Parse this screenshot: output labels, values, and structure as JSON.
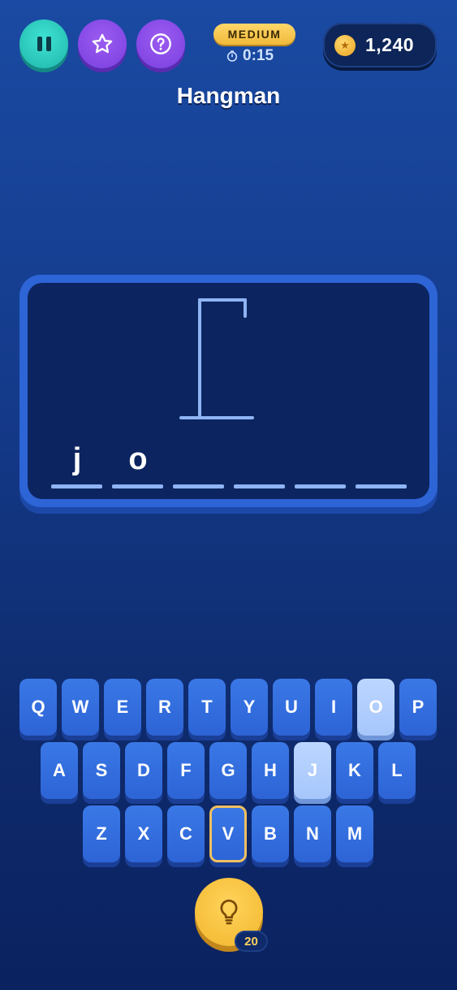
{
  "header": {
    "difficulty": "MEDIUM",
    "timer": "0:15",
    "coins": "1,240",
    "title": "Hangman"
  },
  "icons": {
    "pause": "pause-icon",
    "star": "star-icon",
    "help": "question-icon",
    "timer": "stopwatch-icon",
    "coin": "coin-icon",
    "hint": "lightbulb-icon"
  },
  "colors": {
    "accent_teal": "#1fb6ab",
    "accent_purple": "#7a3fe0",
    "gold": "#f2b52b",
    "key_blue": "#2d64d6",
    "key_used": "#a6c6fb",
    "focus_outline": "#f0c060"
  },
  "word": {
    "slots": [
      "j",
      "o",
      "",
      "",
      "",
      ""
    ]
  },
  "keyboard": {
    "row1": [
      "Q",
      "W",
      "E",
      "R",
      "T",
      "Y",
      "U",
      "I",
      "O",
      "P"
    ],
    "row2": [
      "A",
      "S",
      "D",
      "F",
      "G",
      "H",
      "J",
      "K",
      "L"
    ],
    "row3": [
      "Z",
      "X",
      "C",
      "V",
      "B",
      "N",
      "M"
    ],
    "used_letters": [
      "O",
      "J"
    ],
    "focused_letter": "V"
  },
  "hint": {
    "count": "20"
  }
}
